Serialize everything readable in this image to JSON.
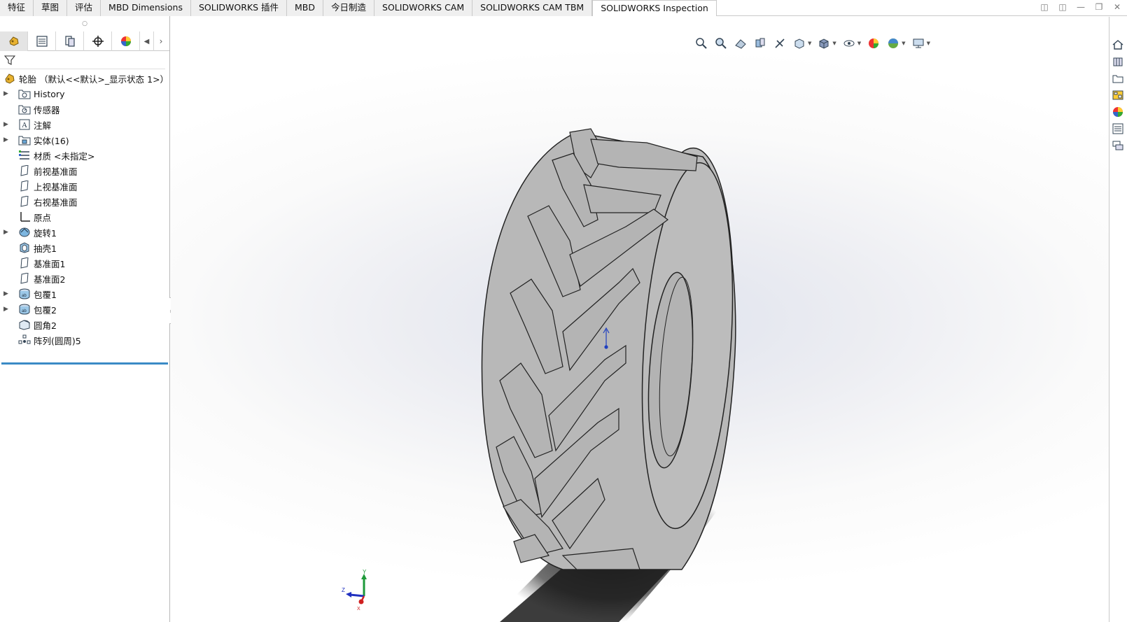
{
  "commandmanager": {
    "tabs": [
      {
        "label": "特征"
      },
      {
        "label": "草图"
      },
      {
        "label": "评估"
      },
      {
        "label": "MBD Dimensions"
      },
      {
        "label": "SOLIDWORKS 插件"
      },
      {
        "label": "MBD"
      },
      {
        "label": "今日制造"
      },
      {
        "label": "SOLIDWORKS CAM"
      },
      {
        "label": "SOLIDWORKS CAM TBM"
      },
      {
        "label": "SOLIDWORKS Inspection"
      }
    ],
    "active_tab": "SOLIDWORKS Inspection"
  },
  "feature_tree": {
    "root_label": "轮胎 （默认<<默认>_显示状态 1>）",
    "items": [
      {
        "label": "History",
        "icon": "history-folder-icon",
        "expandable": true
      },
      {
        "label": "传感器",
        "icon": "sensor-folder-icon",
        "expandable": false
      },
      {
        "label": "注解",
        "icon": "annotation-icon",
        "expandable": true
      },
      {
        "label": "实体(16)",
        "icon": "solid-bodies-icon",
        "expandable": true
      },
      {
        "label": "材质 <未指定>",
        "icon": "material-icon",
        "expandable": false
      },
      {
        "label": "前视基准面",
        "icon": "plane-icon",
        "expandable": false
      },
      {
        "label": "上视基准面",
        "icon": "plane-icon",
        "expandable": false
      },
      {
        "label": "右视基准面",
        "icon": "plane-icon",
        "expandable": false
      },
      {
        "label": "原点",
        "icon": "origin-icon",
        "expandable": false
      },
      {
        "label": "旋转1",
        "icon": "revolve-icon",
        "expandable": true
      },
      {
        "label": "抽壳1",
        "icon": "shell-icon",
        "expandable": false
      },
      {
        "label": "基准面1",
        "icon": "plane-icon",
        "expandable": false
      },
      {
        "label": "基准面2",
        "icon": "plane-icon",
        "expandable": false
      },
      {
        "label": "包覆1",
        "icon": "wrap-icon",
        "expandable": true
      },
      {
        "label": "包覆2",
        "icon": "wrap-icon",
        "expandable": true
      },
      {
        "label": "圆角2",
        "icon": "fillet-icon",
        "expandable": false
      },
      {
        "label": "阵列(圆周)5",
        "icon": "circular-pattern-icon",
        "expandable": false
      }
    ]
  },
  "colors": {
    "accent": "#3b8bc6",
    "tire": "#b9b9b9",
    "triad_x": "#d02020",
    "triad_y": "#1e9a3a",
    "triad_z": "#2030c0"
  },
  "triad": {
    "x": "X",
    "y": "Y",
    "z": "Z"
  }
}
